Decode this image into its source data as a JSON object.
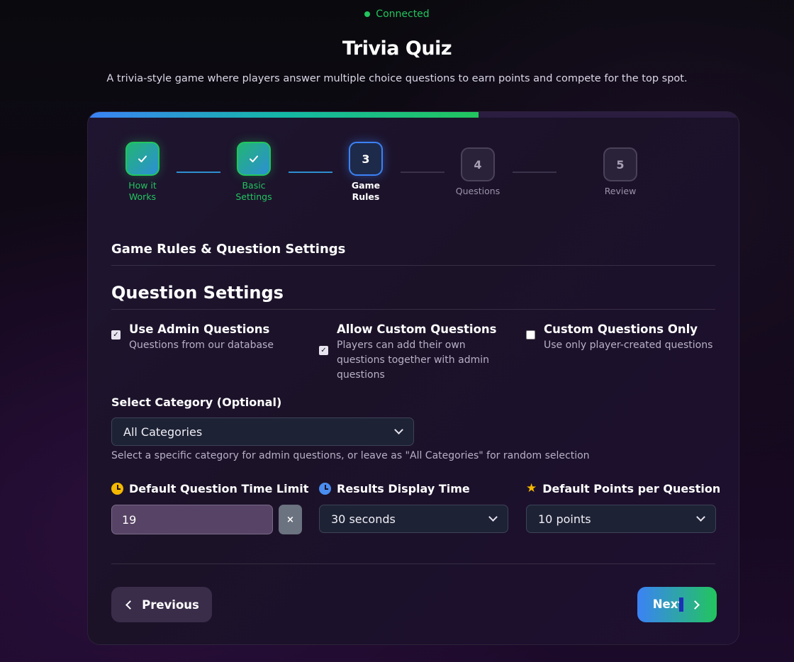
{
  "status": {
    "text": "Connected",
    "color": "#22c55e"
  },
  "app": {
    "title": "Trivia Quiz",
    "subtitle": "A trivia-style game where players answer multiple choice questions to earn points and compete for the top spot."
  },
  "progress": {
    "fraction": 0.6
  },
  "steps": [
    {
      "number": "1",
      "label": "How it Works",
      "state": "done",
      "icon": "check-icon"
    },
    {
      "number": "2",
      "label": "Basic Settings",
      "state": "done",
      "icon": "check-icon"
    },
    {
      "number": "3",
      "label": "Game Rules",
      "state": "current"
    },
    {
      "number": "4",
      "label": "Questions",
      "state": "future"
    },
    {
      "number": "5",
      "label": "Review",
      "state": "future"
    }
  ],
  "section": {
    "title": "Game Rules & Question Settings"
  },
  "question_settings": {
    "title": "Question Settings",
    "options": [
      {
        "title": "Use Admin Questions",
        "desc": "Questions from our database",
        "checked": true
      },
      {
        "title": "Allow Custom Questions",
        "desc": "Players can add their own questions together with admin questions",
        "checked": true
      },
      {
        "title": "Custom Questions Only",
        "desc": "Use only player-created questions",
        "checked": false
      }
    ]
  },
  "category": {
    "label": "Select Category (Optional)",
    "value": "All Categories",
    "hint": "Select a specific category for admin questions, or leave as \"All Categories\" for random selection"
  },
  "time_limit": {
    "label": "Default Question Time Limit",
    "value": "19",
    "clear_label": "×",
    "icon": "clock-icon"
  },
  "results_time": {
    "label": "Results Display Time",
    "value": "30 seconds",
    "icon": "clock-icon"
  },
  "points": {
    "label": "Default Points per Question",
    "value": "10 points",
    "icon": "star-icon"
  },
  "nav": {
    "previous_label": "Previous",
    "next_label": "Next"
  }
}
